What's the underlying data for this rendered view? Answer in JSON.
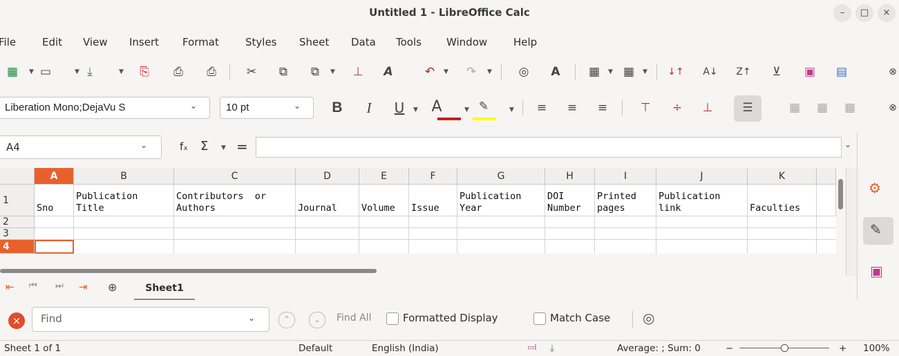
{
  "window": {
    "title": "Untitled 1 - LibreOffice Calc",
    "min": "–",
    "max": "□",
    "close": "×"
  },
  "menu": [
    "File",
    "Edit",
    "View",
    "Insert",
    "Format",
    "Styles",
    "Sheet",
    "Data",
    "Tools",
    "Window",
    "Help"
  ],
  "format_bar": {
    "font_name": "Liberation Mono;DejaVu S",
    "font_size": "10 pt",
    "bold": "B",
    "italic": "I",
    "underline": "U",
    "font_color": "A"
  },
  "formula_bar": {
    "cell_ref": "A4",
    "fx": "fₓ",
    "sum": "Σ",
    "equals": "=",
    "content": ""
  },
  "columns": [
    "A",
    "B",
    "C",
    "D",
    "E",
    "F",
    "G",
    "H",
    "I",
    "J",
    "K"
  ],
  "rows": [
    "1",
    "2",
    "3",
    "4"
  ],
  "row1": [
    {
      "line1": "",
      "line2": "Sno"
    },
    {
      "line1": "Publication",
      "line2": "Title"
    },
    {
      "line1": "Contributors  or",
      "line2": "Authors"
    },
    {
      "line1": "",
      "line2": "Journal"
    },
    {
      "line1": "",
      "line2": "Volume"
    },
    {
      "line1": "",
      "line2": "Issue"
    },
    {
      "line1": "Publication",
      "line2": "Year"
    },
    {
      "line1": "DOI",
      "line2": "Number"
    },
    {
      "line1": "Printed",
      "line2": "pages"
    },
    {
      "line1": "Publication",
      "line2": "link"
    },
    {
      "line1": "",
      "line2": "Faculties"
    }
  ],
  "sheet_tabs": {
    "active": "Sheet1"
  },
  "find_bar": {
    "placeholder": "Find",
    "find_all": "Find All",
    "formatted_display": "Formatted Display",
    "match_case": "Match Case"
  },
  "status": {
    "sheet": "Sheet 1 of 1",
    "style": "Default",
    "language": "English (India)",
    "summary": "Average: ; Sum: 0",
    "zoom": "100%"
  },
  "colors": {
    "selected_header": "#e8602c",
    "font_color_bar": "#c81e1e",
    "highlight_bar": "#ffff00",
    "cursor_border": "#e8602c"
  }
}
